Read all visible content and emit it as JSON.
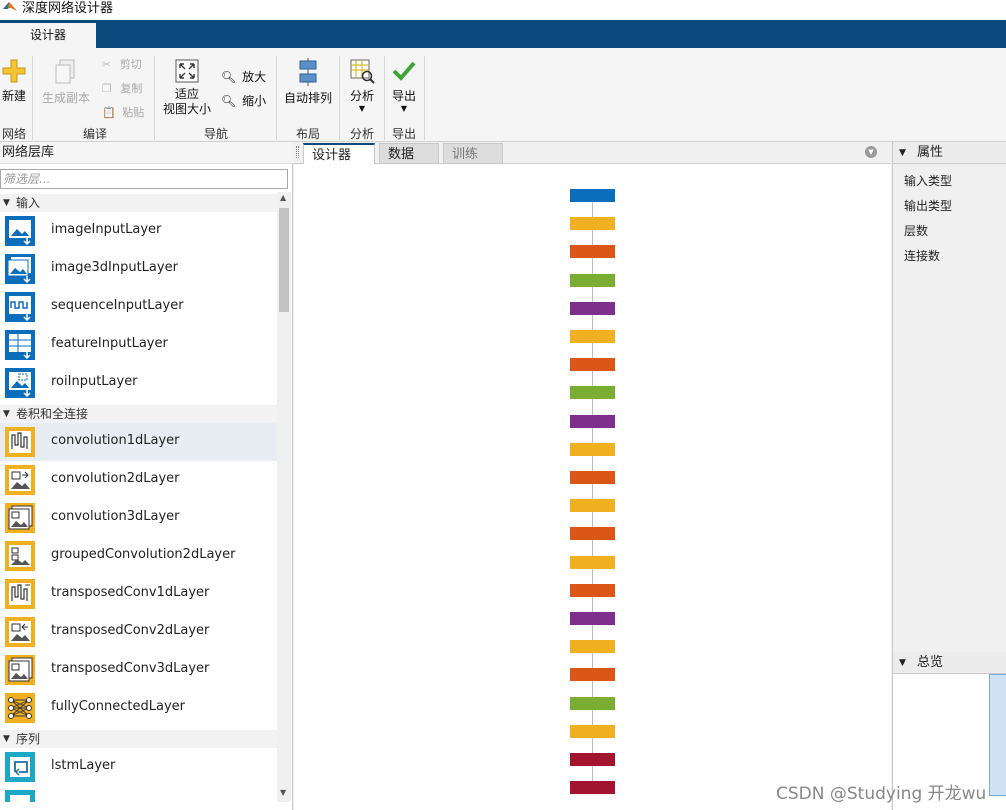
{
  "app": {
    "title": "深度网络设计器",
    "tab": "设计器"
  },
  "ribbon": {
    "new": "新建",
    "duplicate": "生成副本",
    "cut": "剪切",
    "copy": "复制",
    "paste": "粘贴",
    "fit_line1": "适应",
    "fit_line2": "视图大小",
    "zoom_in": "放大",
    "zoom_out": "缩小",
    "auto_arrange": "自动排列",
    "analyze": "分析",
    "export": "导出",
    "groups": [
      "网络",
      "编译",
      "导航",
      "布局",
      "分析",
      "导出"
    ]
  },
  "library": {
    "title": "网络层库",
    "filter_placeholder": "筛选层...",
    "categories": [
      "输入",
      "卷积和全连接",
      "序列"
    ],
    "input_layers": [
      "imageInputLayer",
      "image3dInputLayer",
      "sequenceInputLayer",
      "featureInputLayer",
      "roiInputLayer"
    ],
    "conv_layers": [
      "convolution1dLayer",
      "convolution2dLayer",
      "convolution3dLayer",
      "groupedConvolution2dLayer",
      "transposedConv1dLayer",
      "transposedConv2dLayer",
      "transposedConv3dLayer",
      "fullyConnectedLayer"
    ],
    "seq_layers": [
      "lstmLayer"
    ]
  },
  "doc_tabs": [
    "设计器",
    "数据",
    "训练"
  ],
  "network_nodes": [
    "#0a6ebd",
    "#f0b020",
    "#dc5618",
    "#7aad32",
    "#7e2f8e",
    "#f0b020",
    "#dc5618",
    "#7aad32",
    "#7e2f8e",
    "#f0b020",
    "#dc5618",
    "#f0b020",
    "#dc5618",
    "#f0b020",
    "#dc5618",
    "#7e2f8e",
    "#f0b020",
    "#dc5618",
    "#7aad32",
    "#f0b020",
    "#a2142f",
    "#a2142f"
  ],
  "properties": {
    "title": "属性",
    "fields": [
      "输入类型",
      "输出类型",
      "层数",
      "连接数"
    ]
  },
  "overview": {
    "title": "总览"
  },
  "watermark": "CSDN @Studying 开龙wu"
}
